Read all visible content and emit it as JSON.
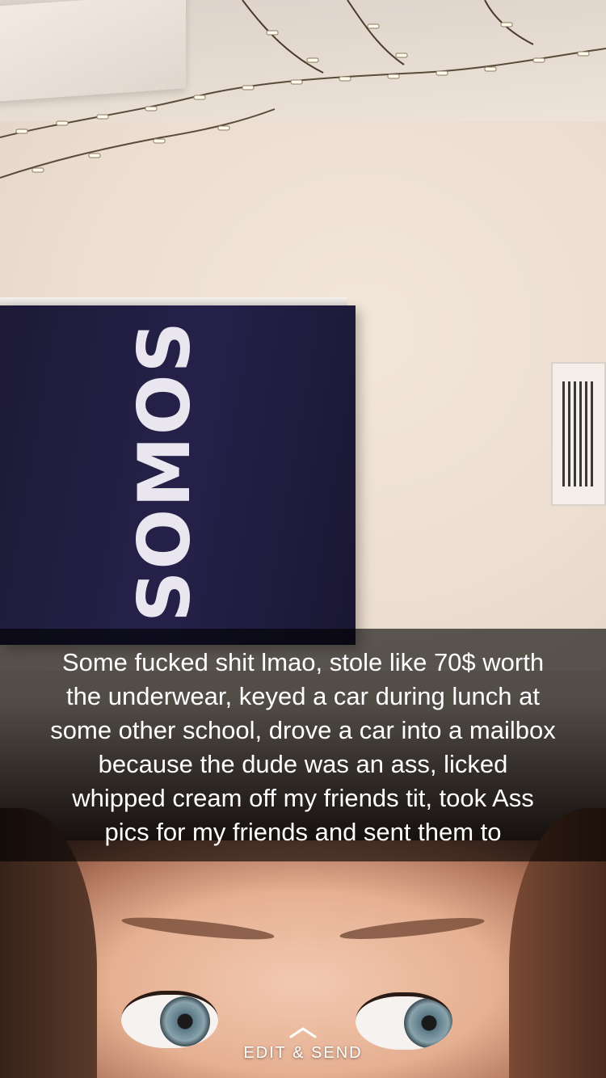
{
  "photo": {
    "flag_text": "SOMOS",
    "caption": "Some fucked shit lmao, stole like 70$ worth\nthe underwear, keyed a car during lunch at\nsome other school, drove a car into a mailbox\nbecause the dude was an ass, licked\nwhipped cream off my friends tit, took Ass\npics for my friends and sent them to"
  },
  "controls": {
    "edit_send_label": "EDIT & SEND",
    "edit_send_icon": "chevron-up-icon"
  },
  "colors": {
    "caption_bar": "#000000",
    "caption_text": "#ffffff",
    "flag": "#1d1a36"
  }
}
